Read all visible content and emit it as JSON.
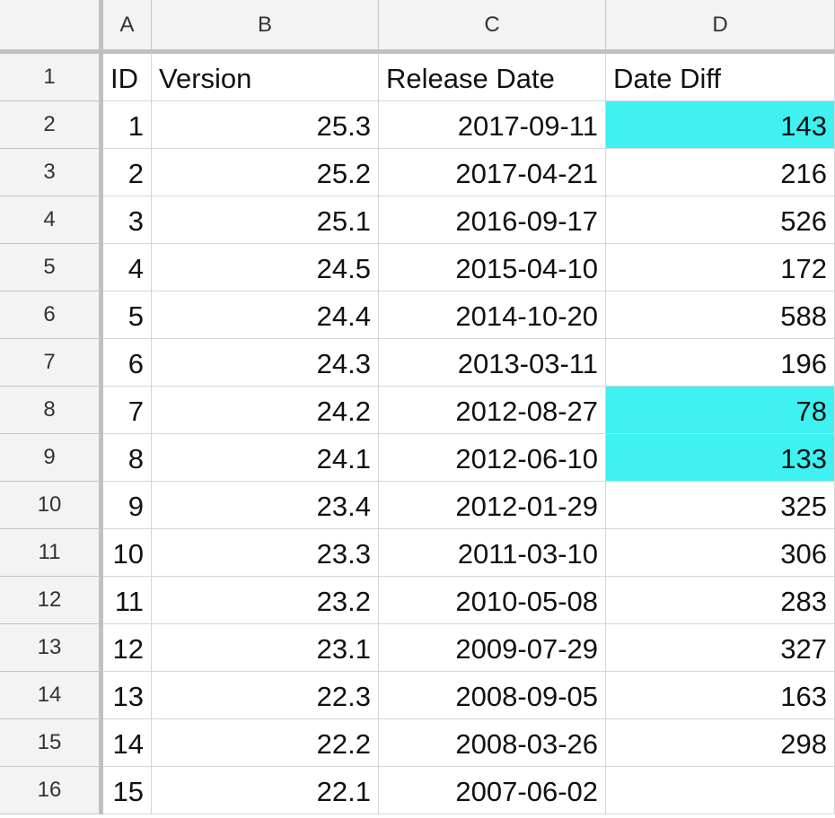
{
  "sheet": {
    "column_headers": [
      "A",
      "B",
      "C",
      "D"
    ],
    "rows": [
      {
        "num": "1",
        "cells": [
          "ID",
          "Version",
          "Release Date",
          "Date Diff"
        ]
      },
      {
        "num": "2",
        "cells": [
          "1",
          "25.3",
          "2017-09-11",
          "143"
        ]
      },
      {
        "num": "3",
        "cells": [
          "2",
          "25.2",
          "2017-04-21",
          "216"
        ]
      },
      {
        "num": "4",
        "cells": [
          "3",
          "25.1",
          "2016-09-17",
          "526"
        ]
      },
      {
        "num": "5",
        "cells": [
          "4",
          "24.5",
          "2015-04-10",
          "172"
        ]
      },
      {
        "num": "6",
        "cells": [
          "5",
          "24.4",
          "2014-10-20",
          "588"
        ]
      },
      {
        "num": "7",
        "cells": [
          "6",
          "24.3",
          "2013-03-11",
          "196"
        ]
      },
      {
        "num": "8",
        "cells": [
          "7",
          "24.2",
          "2012-08-27",
          "78"
        ]
      },
      {
        "num": "9",
        "cells": [
          "8",
          "24.1",
          "2012-06-10",
          "133"
        ]
      },
      {
        "num": "10",
        "cells": [
          "9",
          "23.4",
          "2012-01-29",
          "325"
        ]
      },
      {
        "num": "11",
        "cells": [
          "10",
          "23.3",
          "2011-03-10",
          "306"
        ]
      },
      {
        "num": "12",
        "cells": [
          "11",
          "23.2",
          "2010-05-08",
          "283"
        ]
      },
      {
        "num": "13",
        "cells": [
          "12",
          "23.1",
          "2009-07-29",
          "327"
        ]
      },
      {
        "num": "14",
        "cells": [
          "13",
          "22.3",
          "2008-09-05",
          "163"
        ]
      },
      {
        "num": "15",
        "cells": [
          "14",
          "22.2",
          "2008-03-26",
          "298"
        ]
      },
      {
        "num": "16",
        "cells": [
          "15",
          "22.1",
          "2007-06-02",
          ""
        ]
      }
    ],
    "highlighted_cells": [
      "D2",
      "D8",
      "D9"
    ],
    "highlight_color": "#3ff1f1"
  }
}
